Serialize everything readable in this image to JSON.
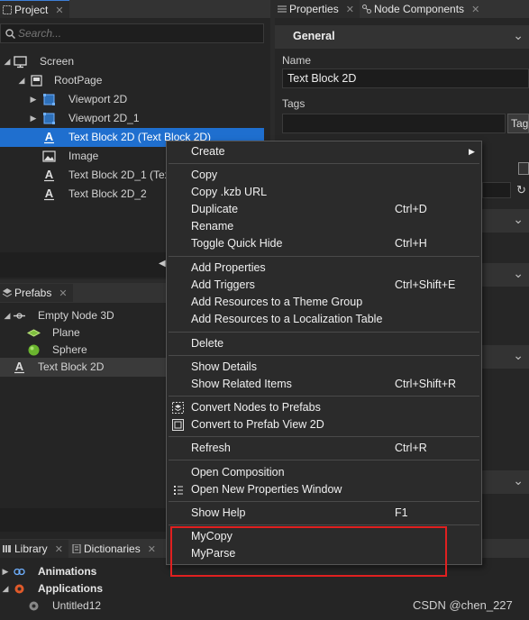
{
  "project_panel": {
    "tab_label": "Project",
    "tab_close": "✕",
    "search_placeholder": "Search...",
    "tree": [
      {
        "label": "Screen",
        "icon": "screen-icon"
      },
      {
        "label": "RootPage",
        "icon": "page-icon"
      },
      {
        "label": "Viewport 2D",
        "icon": "viewport-icon"
      },
      {
        "label": "Viewport 2D_1",
        "icon": "viewport-icon"
      },
      {
        "label": "Text Block 2D (Text Block 2D)",
        "icon": "text-icon",
        "selected": true
      },
      {
        "label": "Image",
        "icon": "image-icon"
      },
      {
        "label": "Text Block 2D_1 (Tex",
        "icon": "text-icon"
      },
      {
        "label": "Text Block 2D_2",
        "icon": "text-icon"
      }
    ]
  },
  "prefabs_panel": {
    "tab_label": "Prefabs",
    "tab_close": "✕",
    "tree": [
      {
        "label": "Empty Node 3D",
        "icon": "node3d-icon"
      },
      {
        "label": "Plane",
        "icon": "plane-icon"
      },
      {
        "label": "Sphere",
        "icon": "sphere-icon"
      },
      {
        "label": "Text Block 2D",
        "icon": "text-icon"
      }
    ]
  },
  "bottom_panel": {
    "tabs": [
      {
        "label": "Library",
        "close": "✕"
      },
      {
        "label": "Dictionaries",
        "close": "✕"
      }
    ],
    "tree": [
      {
        "label": "Animations"
      },
      {
        "label": "Applications"
      },
      {
        "label": "Untitled12"
      }
    ]
  },
  "properties_panel": {
    "tabs": [
      {
        "label": "Properties",
        "close": "✕"
      },
      {
        "label": "Node Components",
        "close": "✕"
      }
    ],
    "section_title": "General",
    "name_label": "Name",
    "name_value": "Text Block 2D",
    "tags_label": "Tags",
    "tags_button": "Tag"
  },
  "context_menu": {
    "items": [
      {
        "label": "Create",
        "shortcut": "",
        "submenu": "▶"
      },
      {
        "label": "Copy",
        "shortcut": ""
      },
      {
        "label": "Copy .kzb URL",
        "shortcut": ""
      },
      {
        "label": "Duplicate",
        "shortcut": "Ctrl+D"
      },
      {
        "label": "Rename",
        "shortcut": ""
      },
      {
        "label": "Toggle Quick Hide",
        "shortcut": "Ctrl+H"
      },
      {
        "label": "Add Properties",
        "shortcut": ""
      },
      {
        "label": "Add Triggers",
        "shortcut": "Ctrl+Shift+E"
      },
      {
        "label": "Add Resources to a Theme Group",
        "shortcut": ""
      },
      {
        "label": "Add Resources to a Localization Table",
        "shortcut": ""
      },
      {
        "label": "Delete",
        "shortcut": ""
      },
      {
        "label": "Show Details",
        "shortcut": ""
      },
      {
        "label": "Show Related Items",
        "shortcut": "Ctrl+Shift+R"
      },
      {
        "label": "Convert Nodes to Prefabs",
        "shortcut": ""
      },
      {
        "label": "Convert to Prefab View 2D",
        "shortcut": ""
      },
      {
        "label": "Refresh",
        "shortcut": "Ctrl+R"
      },
      {
        "label": "Open Composition",
        "shortcut": ""
      },
      {
        "label": "Open New Properties Window",
        "shortcut": ""
      },
      {
        "label": "Show Help",
        "shortcut": "F1"
      },
      {
        "label": "MyCopy",
        "shortcut": ""
      },
      {
        "label": "MyParse",
        "shortcut": ""
      }
    ]
  },
  "watermark": "CSDN @chen_227",
  "colors": {
    "selection": "#1f6fcf",
    "highlight_box": "#e02020",
    "panel_bg": "#2b2b2b",
    "header_bg": "#333333"
  }
}
